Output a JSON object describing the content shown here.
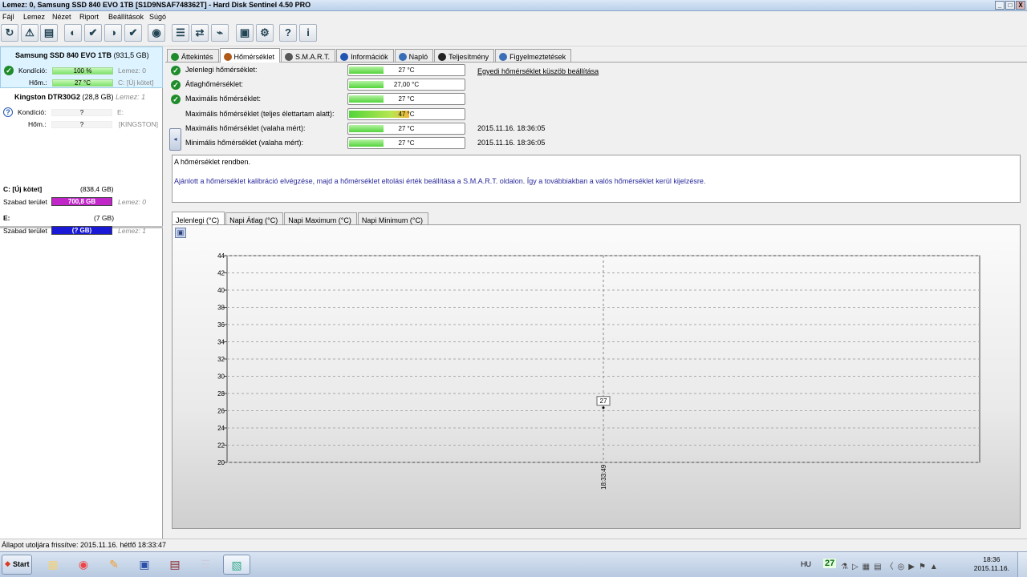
{
  "window": {
    "title": "Lemez: 0, Samsung SSD 840 EVO 1TB [S1D9NSAF748362T]  -  Hard Disk Sentinel 4.50 PRO",
    "buttons": [
      "_",
      " ",
      "X"
    ]
  },
  "menu": [
    "Fájl",
    "Lemez",
    "Nézet",
    "Riport",
    "Beállítások",
    "Súgó"
  ],
  "toolbar": {
    "icons": [
      "refresh-icon",
      "warning-icon",
      "disk-icon",
      "drive-gray-icon",
      "drive-check-icon",
      "drive-green-icon",
      "drive-check2-icon",
      "globe-icon",
      "report-icon",
      "sync-icon",
      "network-icon",
      "monitor-icon",
      "gear-icon",
      "help-icon",
      "info-icon"
    ],
    "glyphs": [
      "↻",
      "⚠",
      "▤",
      "◐",
      "✔",
      "◑",
      "✔",
      "◉",
      "☰",
      "⇄",
      "⌁",
      "▣",
      "⚙",
      "?",
      "i"
    ]
  },
  "disks": [
    {
      "name": "Samsung SSD 840 EVO 1TB",
      "size": "(931,5 GB)",
      "cond_label": "Kondíció:",
      "cond_value": "100 %",
      "cond_extra": "Lemez: 0",
      "temp_label": "Hőm.:",
      "temp_value": "27 °C",
      "temp_extra": "C: [Új kötet]"
    },
    {
      "name": "Kingston DTR30G2",
      "size": "(28,8 GB)",
      "size_extra": "Lemez: 1",
      "cond_label": "Kondíció:",
      "cond_value": "?",
      "cond_extra": "E:",
      "temp_label": "Hőm.:",
      "temp_value": "?",
      "temp_extra": "[KINGSTON]"
    }
  ],
  "volumes": [
    {
      "name": "C: [Új kötet]",
      "size": "(838,4 GB)",
      "free_label": "Szabad terület",
      "free_value": "700,8 GB",
      "disk": "Lemez: 0",
      "color": "#c026c8"
    },
    {
      "name": "E:",
      "size": "(7 GB)",
      "free_label": "Szabad terület",
      "free_value": "(? GB)",
      "disk": "Lemez: 1",
      "color": "#1a1ad6"
    }
  ],
  "tabs": [
    {
      "label": "Áttekintés",
      "icon": "check-icon",
      "active": false
    },
    {
      "label": "Hőmérséklet",
      "icon": "thermometer-icon",
      "active": true
    },
    {
      "label": "S.M.A.R.T.",
      "icon": "smart-icon",
      "active": false
    },
    {
      "label": "Információk",
      "icon": "info-icon",
      "active": false
    },
    {
      "label": "Napló",
      "icon": "log-icon",
      "active": false
    },
    {
      "label": "Teljesítmény",
      "icon": "performance-icon",
      "active": false
    },
    {
      "label": "Figyelmeztetések",
      "icon": "alerts-icon",
      "active": false
    }
  ],
  "temps": [
    {
      "label": "Jelenlegi hőmérséklet:",
      "value": "27 °C",
      "level": 0.27,
      "ok": true,
      "date": ""
    },
    {
      "label": "Átlaghőmérséklet:",
      "value": "27,00 °C",
      "level": 0.27,
      "ok": true,
      "date": ""
    },
    {
      "label": "Maximális hőmérséklet:",
      "value": "27 °C",
      "level": 0.27,
      "ok": true,
      "date": ""
    },
    {
      "label": "Maximális hőmérséklet (teljes élettartam alatt):",
      "value": "47 °C",
      "level": 0.47,
      "ok": false,
      "date": ""
    },
    {
      "label": "Maximális hőmérséklet (valaha mért):",
      "value": "27 °C",
      "level": 0.27,
      "ok": false,
      "date": "2015.11.16. 18:36:05"
    },
    {
      "label": "Minimális hőmérséklet (valaha mért):",
      "value": "27 °C",
      "level": 0.27,
      "ok": false,
      "date": "2015.11.16. 18:36:05"
    }
  ],
  "threshold_link": "Egyedi hőmérséklet küszöb beállítása",
  "messages": {
    "status": "A hőmérséklet rendben.",
    "advice": "Ajánlott a hőmérséklet kalibráció elvégzése, majd a hőmérséklet eltolási érték beállítása a S.M.A.R.T. oldalon. Így a továbbiakban a valós hőmérséklet kerül kijelzésre."
  },
  "chart_tabs": [
    "Jelenlegi (°C)",
    "Napi Átlag (°C)",
    "Napi Maximum (°C)",
    "Napi Minimum (°C)"
  ],
  "chart_data": {
    "type": "line",
    "x": [
      "18:33:49"
    ],
    "series": [
      {
        "values": [
          27
        ]
      }
    ],
    "ylim": [
      20,
      44
    ],
    "yticks": [
      "20",
      "22",
      "24",
      "26",
      "28",
      "30",
      "32",
      "34",
      "36",
      "38",
      "40",
      "42",
      "44"
    ],
    "point_labels": [
      "27"
    ],
    "grid": true
  },
  "status_bar": "Állapot utoljára frissítve: 2015.11.16. hétfő 18:33:47",
  "taskbar": {
    "start": "Start",
    "apps": [
      "folder-icon",
      "chrome-icon",
      "paint-icon",
      "save-icon",
      "archive-icon",
      "notepad-icon",
      "hds-icon"
    ],
    "glyphs": [
      "▦",
      "◉",
      "✎",
      "▣",
      "▤",
      "☰",
      "▧"
    ],
    "lang": "HU",
    "tray_temp": "27",
    "time": "18:36",
    "date": "2015.11.16."
  }
}
